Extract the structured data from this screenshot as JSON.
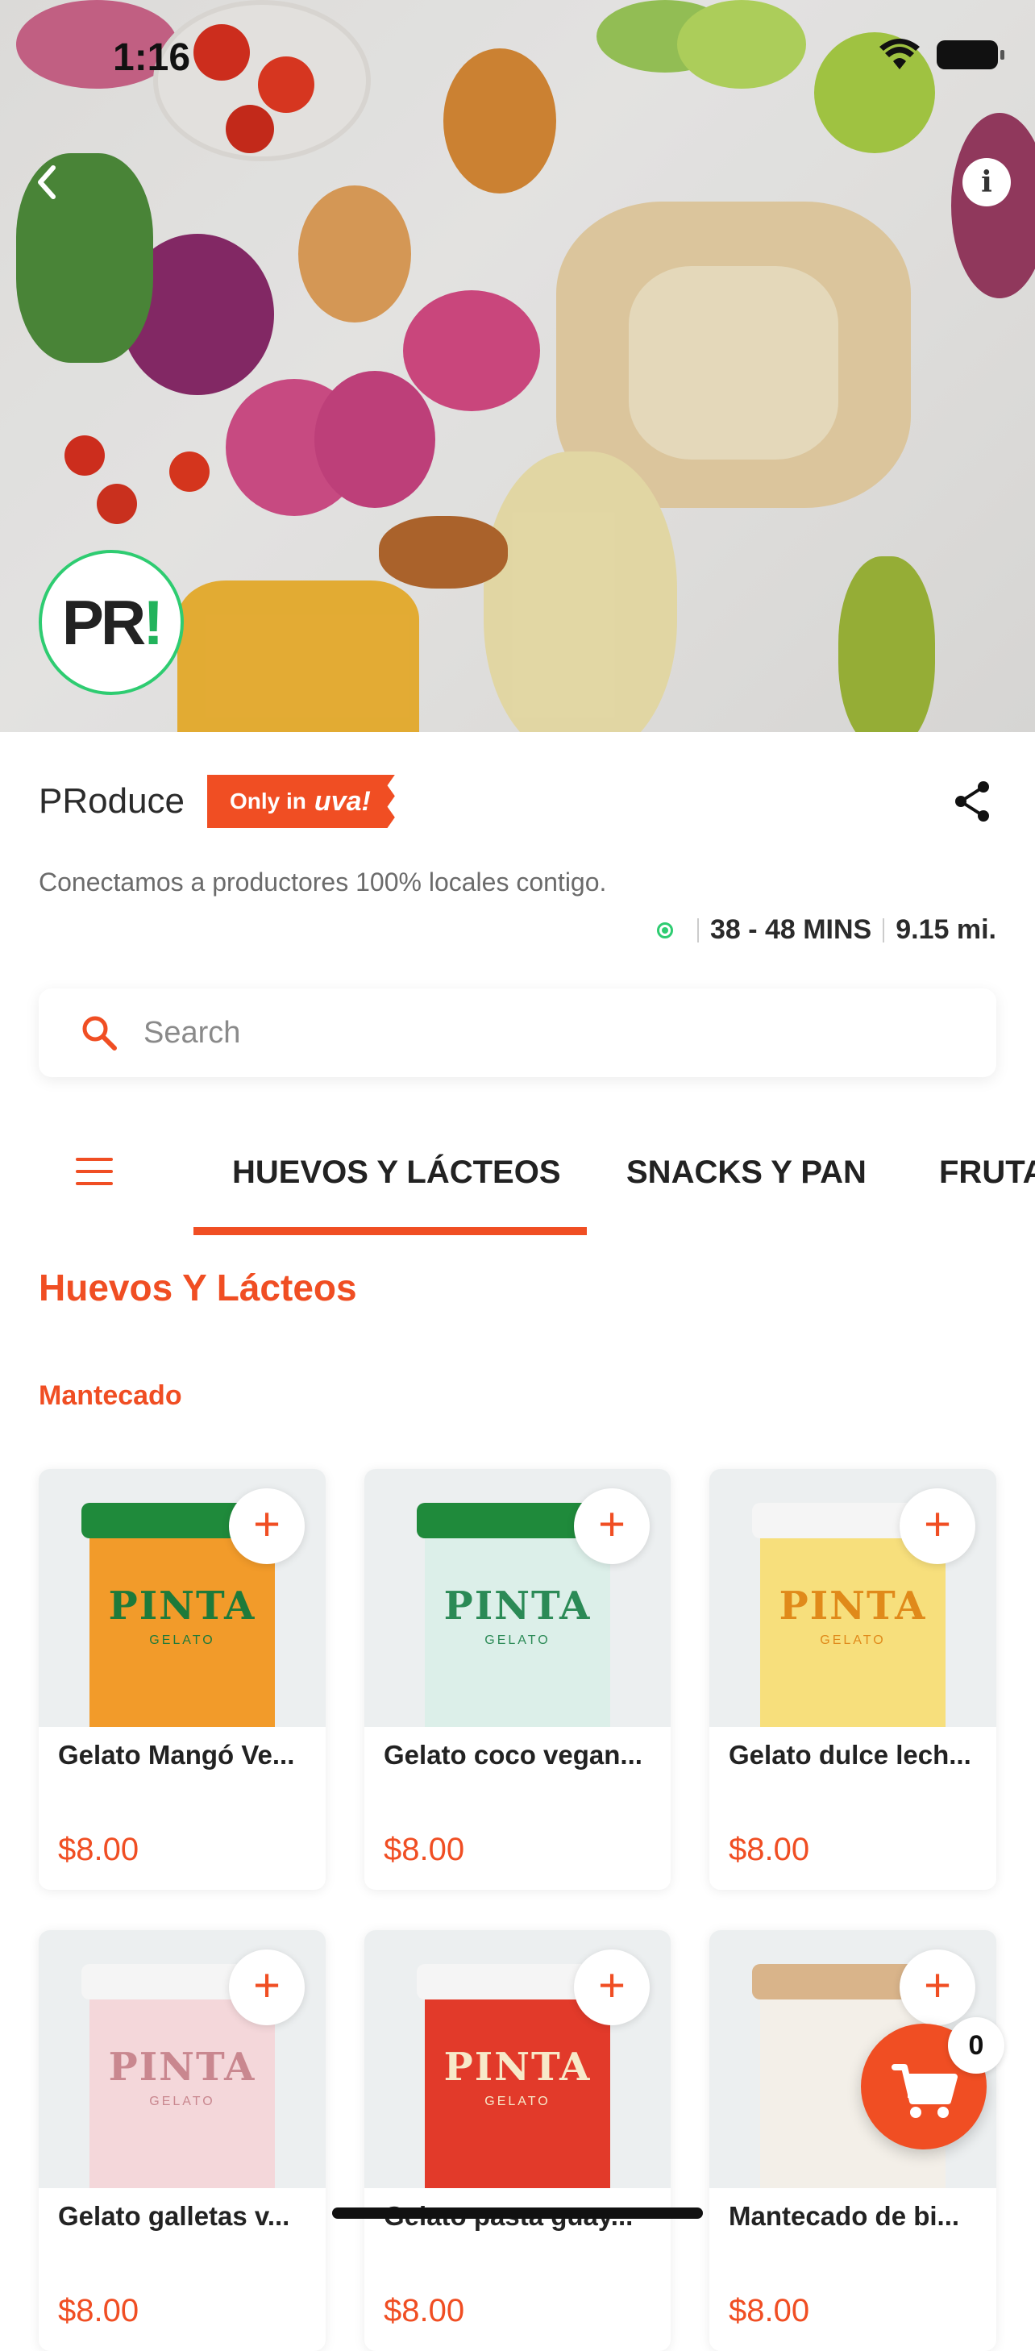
{
  "status": {
    "time": "1:16"
  },
  "store": {
    "name": "PRoduce",
    "badge_prefix": "Only in",
    "badge_brand": "uva!",
    "logo_text": "PR",
    "logo_bang": "!",
    "description": "Conectamos a productores 100% locales contigo.",
    "eta": "38 - 48 MINS",
    "distance": "9.15 mi."
  },
  "search": {
    "placeholder": "Search"
  },
  "tabs": [
    "HUEVOS Y LÁCTEOS",
    "SNACKS Y PAN",
    "FRUTAS"
  ],
  "section": {
    "title": "Huevos Y Lácteos",
    "subtitle": "Mantecado"
  },
  "products": [
    {
      "name": "Gelato Mangó Ve...",
      "price": "$8.00",
      "color": "#f29b2a",
      "lid": "#1f8a3b",
      "label": "PINTA",
      "label_color": "#1e7a3a"
    },
    {
      "name": "Gelato coco vegan...",
      "price": "$8.00",
      "color": "#dcefe9",
      "lid": "#1f8a3b",
      "label": "PINTA",
      "label_color": "#2b8a56"
    },
    {
      "name": "Gelato dulce lech...",
      "price": "$8.00",
      "color": "#f7df7c",
      "lid": "#f5f5f5",
      "label": "PINTA",
      "label_color": "#e08a1a"
    },
    {
      "name": "Gelato galletas v...",
      "price": "$8.00",
      "color": "#f4d7da",
      "lid": "#f5f5f5",
      "label": "PINTA",
      "label_color": "#c9878f"
    },
    {
      "name": "Gelato pasta guay...",
      "price": "$8.00",
      "color": "#e23a2a",
      "lid": "#f5f5f5",
      "label": "PINTA",
      "label_color": "#f7e9c9"
    },
    {
      "name": "Mantecado de bi...",
      "price": "$8.00",
      "color": "#f3efe8",
      "lid": "#d9b48a",
      "label": "",
      "label_color": "#999999"
    }
  ],
  "product_sub": [
    "GELATO",
    "GELATO",
    "GELATO",
    "GELATO",
    "GELATO",
    ""
  ],
  "cart": {
    "count": "0"
  },
  "colors": {
    "accent": "#f04e23",
    "green": "#2ecc71"
  }
}
